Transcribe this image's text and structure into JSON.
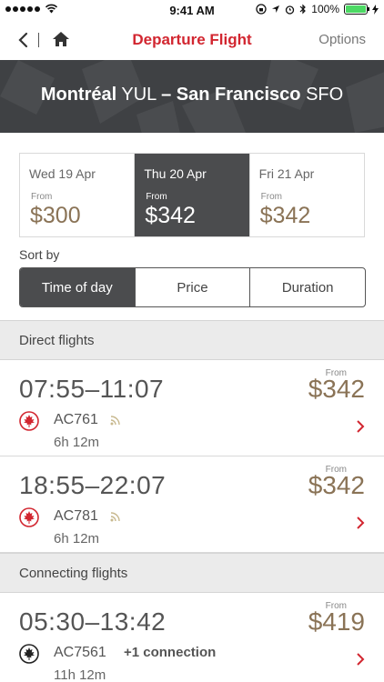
{
  "status_bar": {
    "time": "9:41 AM",
    "battery": "100%",
    "battery_level": 1.0
  },
  "nav": {
    "title": "Departure Flight",
    "options_label": "Options"
  },
  "route": {
    "origin_city": "Montréal",
    "origin_code": "YUL",
    "dash": "–",
    "dest_city": "San Francisco",
    "dest_code": "SFO"
  },
  "dates": [
    {
      "day": "Wed 19 Apr",
      "from": "From",
      "price": "$300",
      "selected": false
    },
    {
      "day": "Thu 20 Apr",
      "from": "From",
      "price": "$342",
      "selected": true
    },
    {
      "day": "Fri 21 Apr",
      "from": "From",
      "price": "$342",
      "selected": false
    }
  ],
  "sort": {
    "label": "Sort by",
    "options": [
      "Time of day",
      "Price",
      "Duration"
    ],
    "active": "Time of day"
  },
  "sections": {
    "direct": "Direct flights",
    "connecting": "Connecting flights"
  },
  "flights": [
    {
      "times": "07:55–11:07",
      "flight_no": "AC761",
      "duration": "6h 12m",
      "from": "From",
      "price": "$342",
      "wifi": true,
      "connection": "",
      "logo": "red-maple-leaf"
    },
    {
      "times": "18:55–22:07",
      "flight_no": "AC781",
      "duration": "6h 12m",
      "from": "From",
      "price": "$342",
      "wifi": true,
      "connection": "",
      "logo": "red-maple-leaf"
    },
    {
      "times": "05:30–13:42",
      "flight_no": "AC7561",
      "duration": "11h 12m",
      "from": "From",
      "price": "$419",
      "wifi": false,
      "connection": "+1 connection",
      "logo": "black-maple-leaf"
    }
  ],
  "colors": {
    "brand_red": "#d22630",
    "price_gold": "#8a7356",
    "dark_gray": "#4b4c4e"
  }
}
